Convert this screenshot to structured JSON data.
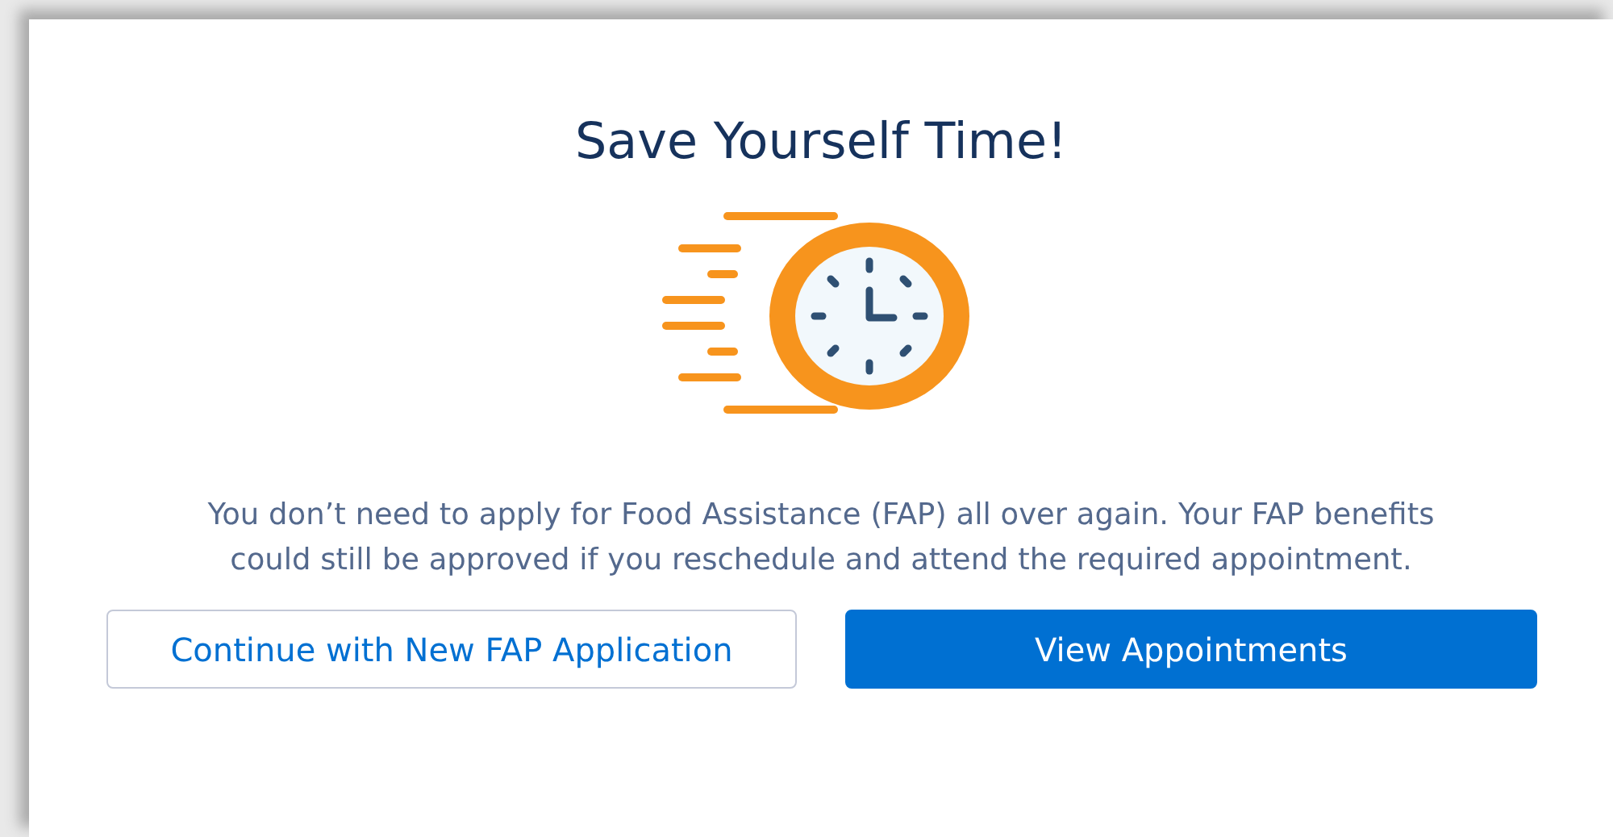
{
  "dialog": {
    "title": "Save Yourself Time!",
    "message": "You don’t need to apply for Food Assistance (FAP) all over again. Your FAP benefits could still be approved if you reschedule and attend the required appointment.",
    "buttons": [
      {
        "label": "Continue with New FAP Application",
        "kind": "outline"
      },
      {
        "label": "View Appointments",
        "kind": "primary"
      }
    ]
  }
}
